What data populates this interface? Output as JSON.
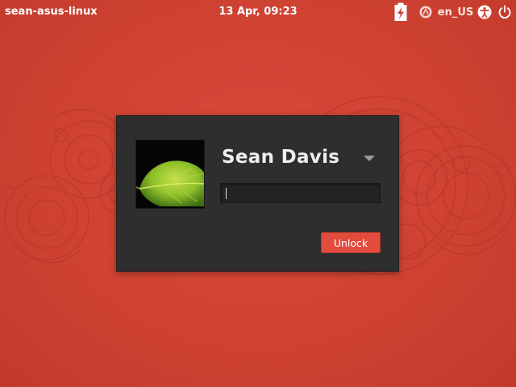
{
  "panel": {
    "hostname": "sean-asus-linux",
    "datetime": "13 Apr, 09:23",
    "language": "en_US",
    "icons": [
      "battery-charging-icon",
      "session-icon",
      "accessibility-icon",
      "power-icon"
    ]
  },
  "login": {
    "username": "Sean Davis",
    "password_value": "",
    "unlock_label": "Unlock",
    "avatar": "leaf-icon"
  },
  "colors": {
    "background": "#cf4232",
    "dialog": "#2e2e2e",
    "button": "#e34c3d",
    "text": "#eeeeee"
  }
}
